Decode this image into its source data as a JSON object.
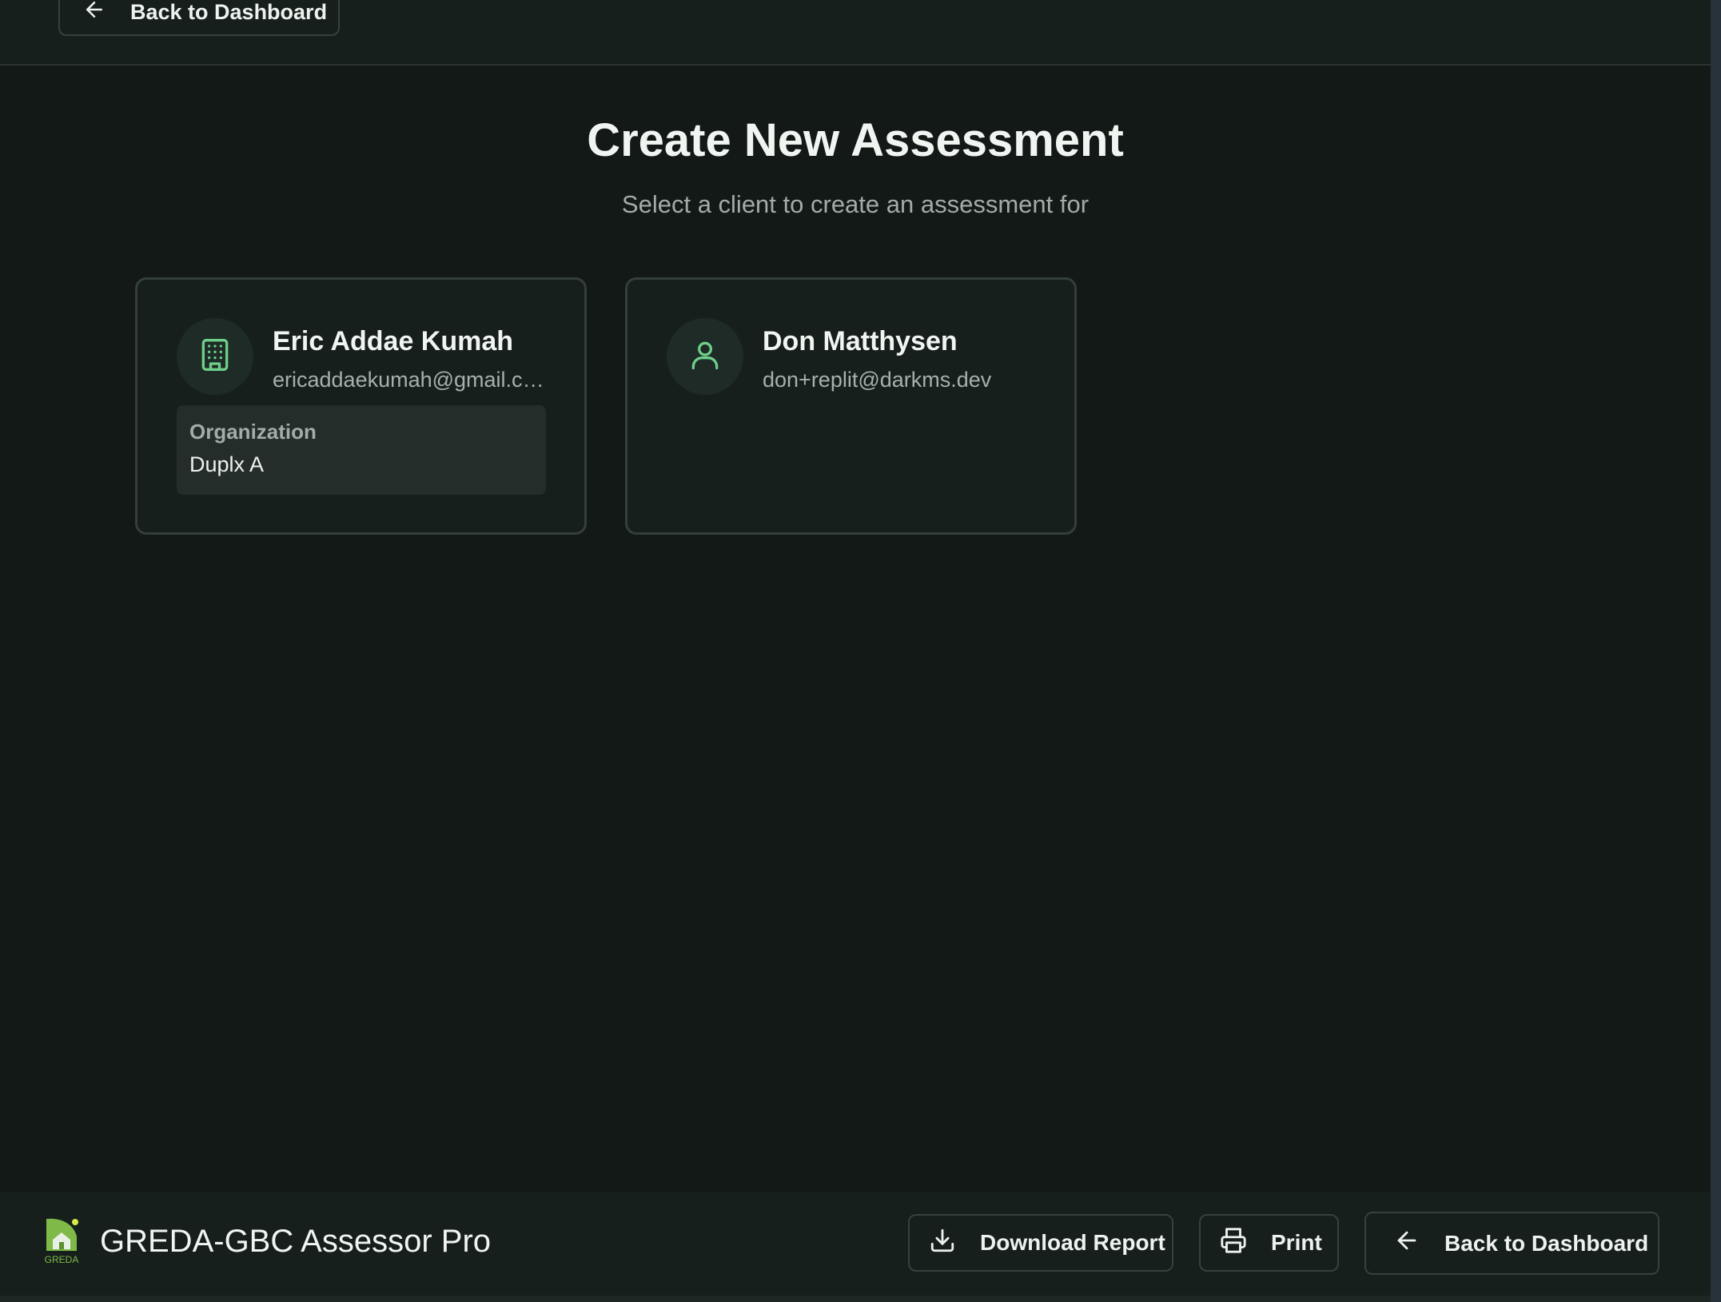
{
  "header": {
    "back_label": "Back to Dashboard"
  },
  "main": {
    "title": "Create New Assessment",
    "subtitle": "Select a client to create an assessment for",
    "clients": [
      {
        "name": "Eric Addae Kumah",
        "email": "ericaddaekumah@gmail.com",
        "icon": "building-icon",
        "organization_label": "Organization",
        "organization": "Duplx A"
      },
      {
        "name": "Don Matthysen",
        "email": "don+replit@darkms.dev",
        "icon": "user-icon"
      }
    ]
  },
  "footer": {
    "app_name": "GREDA-GBC Assessor Pro",
    "logo_text": "GREDA",
    "download_label": "Download Report",
    "print_label": "Print",
    "back_label": "Back to Dashboard"
  },
  "colors": {
    "background": "#121917",
    "accent": "#6fcf8a",
    "card_border": "#333f3a"
  }
}
